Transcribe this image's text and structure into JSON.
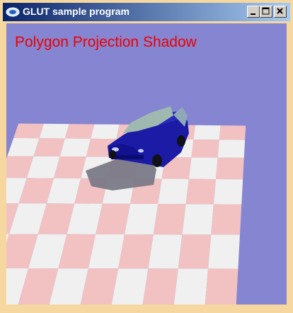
{
  "window": {
    "title": "GLUT sample program",
    "controls": [
      "minimize",
      "maximize",
      "close"
    ]
  },
  "canvas": {
    "caption": "Polygon Projection Shadow",
    "caption_color": "#ee0000",
    "background_color": "#8585d2",
    "floor_colors": [
      "#f2c2c2",
      "#f0f0f0"
    ],
    "car_color": "#1e1ea8",
    "shadow_color": "#7a7a88"
  },
  "icons": {
    "app": "glut-app-icon",
    "minimize": "minimize-icon",
    "maximize": "maximize-icon",
    "close": "close-icon"
  }
}
